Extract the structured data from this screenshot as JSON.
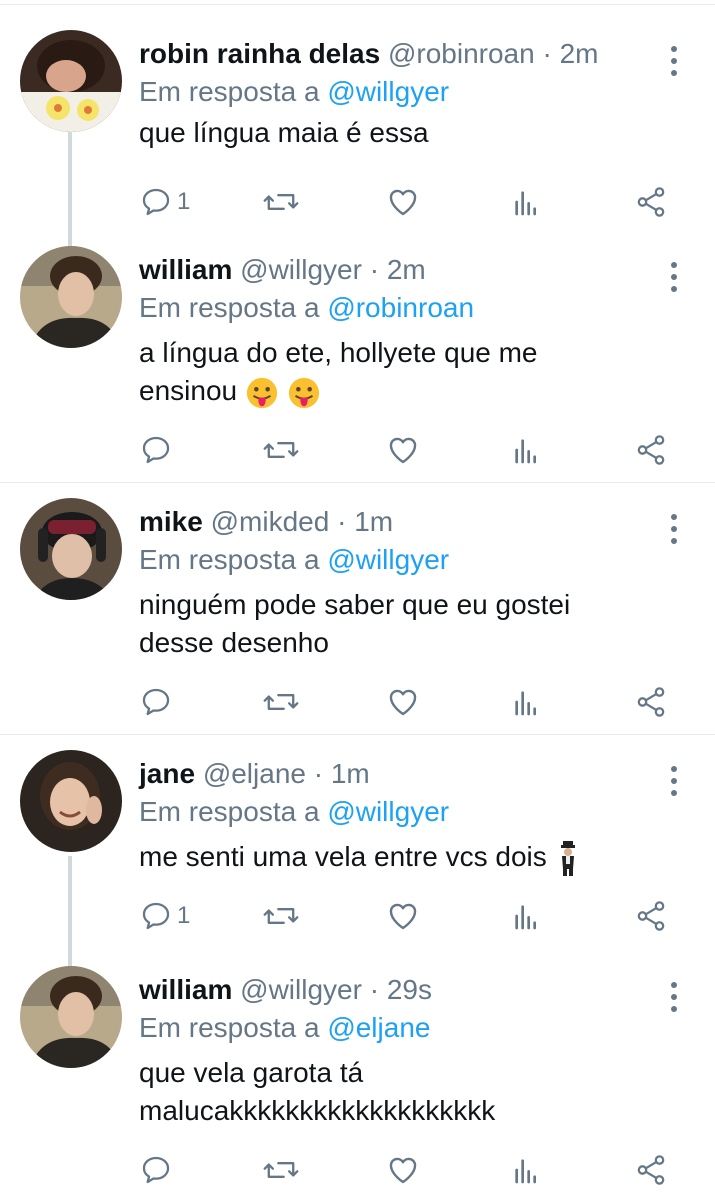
{
  "tweets": [
    {
      "name": "robin rainha delas",
      "handle": "@robinroan",
      "sep": "·",
      "time": "2m",
      "reply_prefix": "Em resposta a ",
      "reply_to": "@willgyer",
      "text": "que língua maia é essa",
      "reply_count": "1"
    },
    {
      "name": "william",
      "handle": "@willgyer",
      "sep": "·",
      "time": "2m",
      "reply_prefix": "Em resposta a ",
      "reply_to": "@robinroan",
      "text_line1": "a língua do ete, hollyete que me",
      "text_line2": "ensinou",
      "emojis": [
        "face-with-tongue",
        "face-with-tongue"
      ]
    },
    {
      "name": "mike",
      "handle": "@mikded",
      "sep": "·",
      "time": "1m",
      "reply_prefix": "Em resposta a ",
      "reply_to": "@willgyer",
      "text_line1": "ninguém pode saber que eu gostei",
      "text_line2": "desse desenho"
    },
    {
      "name": "jane",
      "handle": "@eljane",
      "sep": "·",
      "time": "1m",
      "reply_prefix": "Em resposta a ",
      "reply_to": "@willgyer",
      "text": "me senti uma vela entre vcs dois",
      "emojis": [
        "man-in-business-suit-levitating"
      ],
      "reply_count": "1"
    },
    {
      "name": "william",
      "handle": "@willgyer",
      "sep": "·",
      "time": "29s",
      "reply_prefix": "Em resposta a ",
      "reply_to": "@eljane",
      "text_line1": "que vela garota tá",
      "text_line2": "malucakkkkkkkkkkkkkkkkkkk"
    }
  ],
  "icons": {
    "reply": "comment-icon",
    "retweet": "retweet-icon",
    "like": "heart-icon",
    "analytics": "analytics-icon",
    "share": "share-icon",
    "more": "more-vertical-icon"
  },
  "colors": {
    "mention": "#1da1f2",
    "secondary_text": "#657786",
    "icon": "#657786",
    "thread_line": "#cfd9de",
    "divider": "#e6ecf0"
  }
}
